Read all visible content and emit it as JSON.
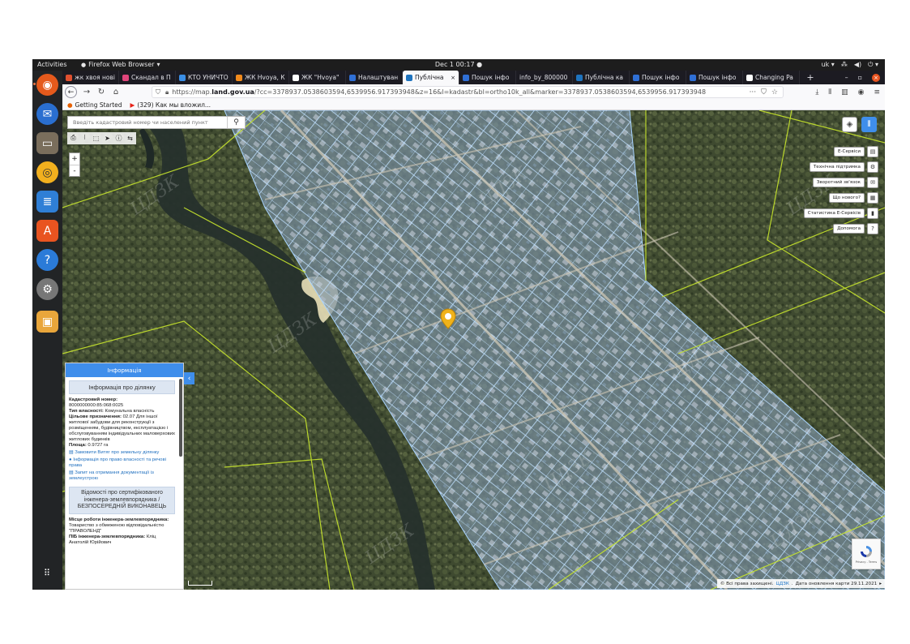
{
  "system": {
    "activities": "Activities",
    "app_name": "Firefox Web Browser",
    "clock": "Dec 1  00:17",
    "lang": "uk"
  },
  "browser": {
    "tabs": [
      {
        "title": "жк хвоя нові",
        "fav": "#e0502f",
        "favicon": "g",
        "active": false
      },
      {
        "title": "Скандал в П",
        "fav": "#e0457b",
        "favicon": "y",
        "active": false
      },
      {
        "title": "КТО УНИЧТО",
        "fav": "#3a8ee6",
        "favicon": "k",
        "active": false
      },
      {
        "title": "ЖК Hvoya, К",
        "fav": "#f18a1c",
        "favicon": "h",
        "active": false
      },
      {
        "title": "ЖК \"Hvoya\"",
        "fav": "#ffffff",
        "favicon": "house",
        "active": false
      },
      {
        "title": "Налаштуван",
        "fav": "#2f6fd6",
        "favicon": "E",
        "active": false
      },
      {
        "title": "Публічна",
        "fav": "#1e73be",
        "favicon": "map",
        "active": true
      },
      {
        "title": "Пошук інфо",
        "fav": "#2f6fd6",
        "favicon": "E",
        "active": false
      },
      {
        "title": "info_by_800000",
        "fav": "",
        "favicon": "",
        "active": false
      },
      {
        "title": "Публічна ка",
        "fav": "#1e73be",
        "favicon": "map",
        "active": false
      },
      {
        "title": "Пошук інфо",
        "fav": "#2f6fd6",
        "favicon": "E",
        "active": false
      },
      {
        "title": "Пошук інфо",
        "fav": "#2f6fd6",
        "favicon": "E",
        "active": false
      },
      {
        "title": "Changing Pa",
        "fav": "#ffffff",
        "favicon": "doc",
        "active": false
      }
    ],
    "url_prefix": "https://map.",
    "url_domain": "land.gov.ua",
    "url_rest": "/?cc=3378937.0538603594,6539956.917393948&z=16&l=kadastr&bl=ortho10k_all&marker=3378937.0538603594,6539956.917393948",
    "bookmarks": [
      {
        "label": "Getting Started",
        "icon": "firefox-icon"
      },
      {
        "label": "(329) Как мы вложил...",
        "icon": "youtube-icon"
      }
    ]
  },
  "map": {
    "search_placeholder": "Введіть кадастровий номер чи населений пункт",
    "zoom_in": "+",
    "zoom_out": "-",
    "services": [
      {
        "label": "Е-Сервіси",
        "icon": "▤"
      },
      {
        "label": "Технічна підтримка",
        "icon": "⚙"
      },
      {
        "label": "Зворотний зв'язок",
        "icon": "✉"
      },
      {
        "label": "Що нового?",
        "icon": "▦"
      },
      {
        "label": "Статистика Е-Сервісів",
        "icon": "▮"
      },
      {
        "label": "Допомога",
        "icon": "?"
      }
    ],
    "attribution_prefix": "© Всі права захищені.",
    "attribution_link": "ЦДЗК",
    "attribution_date": "Дата оновлення карти 29.11.2021",
    "recaptcha_text": "Privacy - Terms",
    "colors": {
      "parcel_fill": "#8fc2ff",
      "parcel_stroke": "#a9d4ff",
      "boundary": "#c8e62c",
      "marker": "#f0b21a"
    }
  },
  "info": {
    "header": "Інформація",
    "parcel_title": "Інформація про ділянку",
    "cadastral_label": "Кадастровий номер:",
    "cadastral_value": "8000000000:85:068:0025",
    "ownership_label": "Тип власності:",
    "ownership_value": "Комунальна власність",
    "purpose_label": "Цільове призначення:",
    "purpose_value": "02.07 Для іншої житлової забудови для реконструкції з розміщенням, будівництвом, експлуатацією і обслуговуванням індивідуальних маловерхових житлових будинків",
    "area_label": "Площа:",
    "area_value": "0.9727 га",
    "links": [
      {
        "label": "Замовити Витяг про земельну ділянку",
        "icon": "▤"
      },
      {
        "label": "Інформація про право власності та речові права",
        "icon": "●"
      },
      {
        "label": "Запит на отримання документації із землеустрою",
        "icon": "▤"
      }
    ],
    "engineer_title": "Відомості про сертифікованого інженера-землевпорядника / БЕЗПОСЕРЕДНІЙ ВИКОНАВЕЦЬ",
    "workplace_label": "Місце роботи інженера-землевпорядника:",
    "workplace_value": "Товариство з обмеженою відповідальністю \"ПРАВОЛЕНД\"",
    "name_label": "ПІБ інженера-землевпорядника:",
    "name_value": "Кліц Анатолій Юрійович"
  }
}
